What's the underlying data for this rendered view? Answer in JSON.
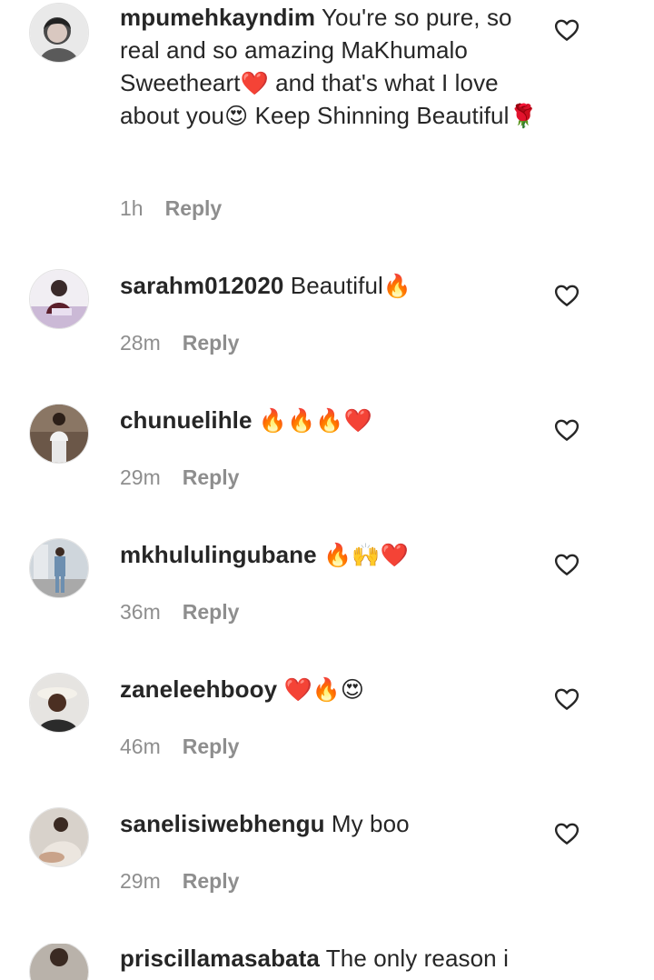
{
  "comments": [
    {
      "username": "mpumehkayndim",
      "text_parts": [
        "You're so pure, so real and so amazing MaKhumalo Sweetheart",
        "❤️",
        " and that's what I love about you",
        "😍",
        " Keep Shinning Beautiful",
        "🌹"
      ],
      "time": "1h",
      "reply": "Reply"
    },
    {
      "username": "sarahm012020",
      "text": "Beautiful",
      "emojis": "🔥",
      "time": "28m",
      "reply": "Reply"
    },
    {
      "username": "chunuelihle",
      "text": "",
      "emojis": "🔥🔥🔥❤️",
      "time": "29m",
      "reply": "Reply"
    },
    {
      "username": "mkhululingubane",
      "text": "",
      "emojis": "🔥🙌❤️",
      "time": "36m",
      "reply": "Reply"
    },
    {
      "username": "zaneleehbooy",
      "text": "",
      "emojis": "❤️🔥😍",
      "time": "46m",
      "reply": "Reply"
    },
    {
      "username": "sanelisiwebhengu",
      "text": "My boo",
      "emojis": "",
      "time": "29m",
      "reply": "Reply"
    },
    {
      "username": "priscillamasabata",
      "text": "The only reason i",
      "emojis": "",
      "time": "",
      "reply": ""
    }
  ],
  "icons": {
    "like": "heart-outline-icon",
    "avatar": "user-avatar"
  },
  "colors": {
    "text": "#262626",
    "meta": "#8e8e8e",
    "background": "#ffffff"
  }
}
